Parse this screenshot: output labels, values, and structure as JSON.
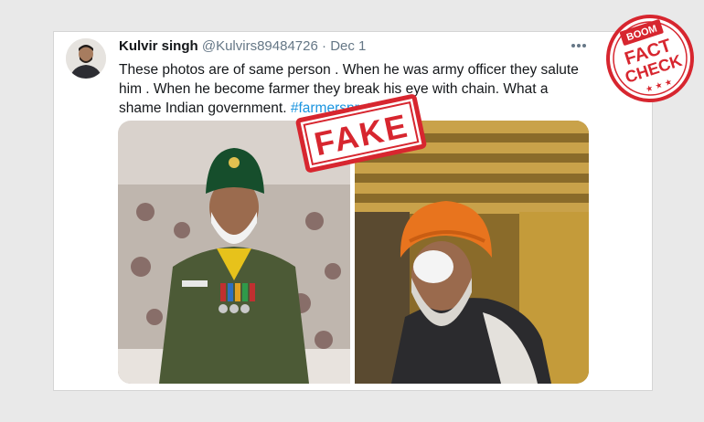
{
  "tweet": {
    "name": "Kulvir singh",
    "handle": "@Kulvirs89484726",
    "separator": "·",
    "date": "Dec 1",
    "more_icon": "more-icon",
    "text": "These photos are of same person . When he was army officer they salute him . When he become farmer they break his eye with chain. What a shame Indian government.",
    "hashtag": "#farmersprotest"
  },
  "stamps": {
    "fake_label": "FAKE",
    "factcheck_brand": "BOOM",
    "factcheck_line1": "FACT",
    "factcheck_line2": "CHECK",
    "stars": "★ ★ ★"
  },
  "colors": {
    "stamp_red": "#d7262f",
    "link_blue": "#1b95e0",
    "text": "#14171a",
    "muted": "#657786"
  }
}
